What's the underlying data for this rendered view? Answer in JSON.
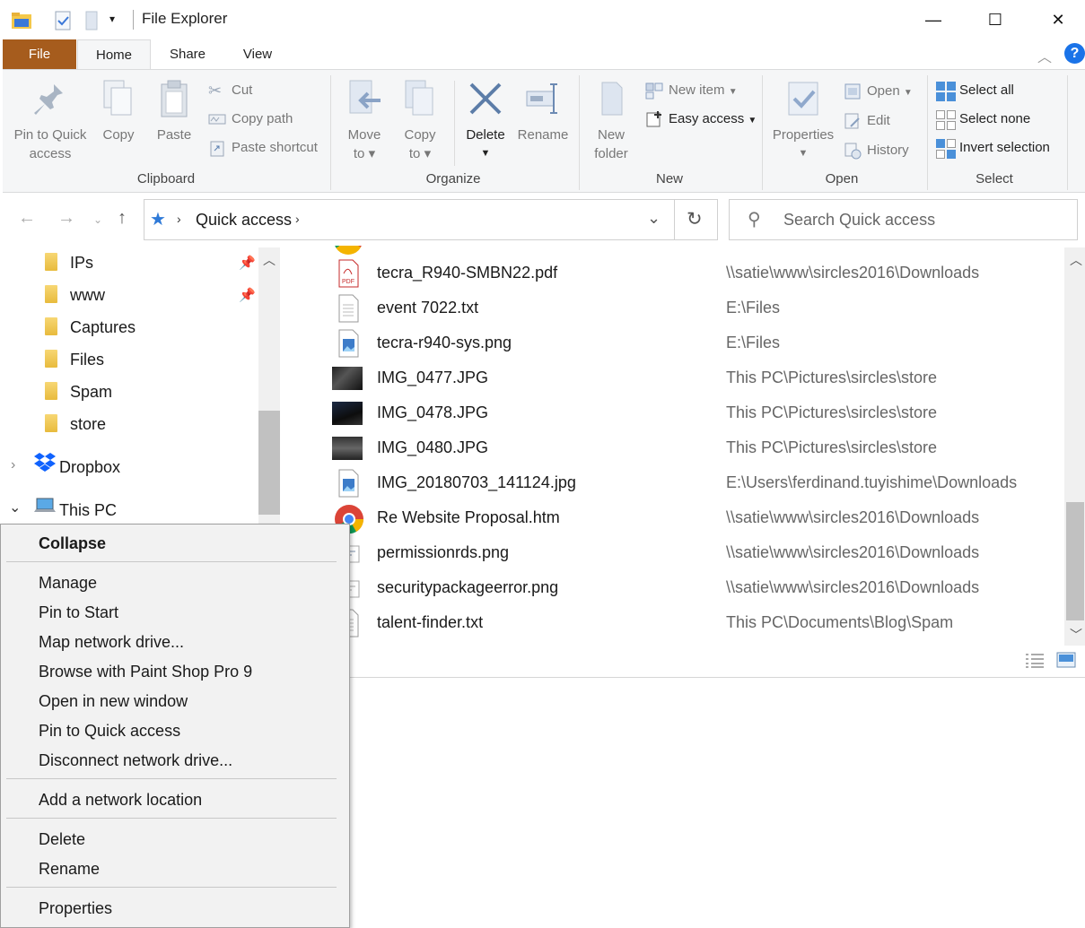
{
  "window": {
    "title": "File Explorer"
  },
  "window_controls": {
    "minimize": "—",
    "maximize": "☐",
    "close": "✕"
  },
  "tabs": [
    {
      "label": "File"
    },
    {
      "label": "Home"
    },
    {
      "label": "Share"
    },
    {
      "label": "View"
    }
  ],
  "ribbon": {
    "clipboard": {
      "label": "Clipboard",
      "pin_line1": "Pin to Quick",
      "pin_line2": "access",
      "copy": "Copy",
      "paste": "Paste",
      "cut": "Cut",
      "copy_path": "Copy path",
      "paste_shortcut": "Paste shortcut"
    },
    "organize": {
      "label": "Organize",
      "move_line1": "Move",
      "move_line2": "to",
      "copy_line1": "Copy",
      "copy_line2": "to",
      "delete": "Delete",
      "rename": "Rename"
    },
    "new": {
      "label": "New",
      "new_folder_line1": "New",
      "new_folder_line2": "folder",
      "new_item": "New item",
      "easy_access": "Easy access"
    },
    "open": {
      "label": "Open",
      "properties": "Properties",
      "open": "Open",
      "edit": "Edit",
      "history": "History"
    },
    "select": {
      "label": "Select",
      "select_all": "Select all",
      "select_none": "Select none",
      "invert_selection": "Invert selection"
    }
  },
  "address": {
    "path": "Quick access",
    "search_placeholder": "Search Quick access"
  },
  "nav_pane": {
    "items": [
      {
        "label": "IPs",
        "pinned": true
      },
      {
        "label": "www",
        "pinned": true
      },
      {
        "label": "Captures",
        "pinned": false
      },
      {
        "label": "Files",
        "pinned": false
      },
      {
        "label": "Spam",
        "pinned": false
      },
      {
        "label": "store",
        "pinned": false
      }
    ],
    "dropbox": "Dropbox",
    "this_pc": "This PC"
  },
  "files": [
    {
      "name": "tecra_R940-SMBN22.pdf",
      "location": "\\\\satie\\www\\sircles2016\\Downloads",
      "icon": "pdf-icon"
    },
    {
      "name": "event 7022.txt",
      "location": "E:\\Files",
      "icon": "text-file-icon"
    },
    {
      "name": "tecra-r940-sys.png",
      "location": "E:\\Files",
      "icon": "image-file-icon"
    },
    {
      "name": "IMG_0477.JPG",
      "location": "This PC\\Pictures\\sircles\\store",
      "icon": "photo-thumbnail-icon"
    },
    {
      "name": "IMG_0478.JPG",
      "location": "This PC\\Pictures\\sircles\\store",
      "icon": "photo-thumbnail-icon"
    },
    {
      "name": "IMG_0480.JPG",
      "location": "This PC\\Pictures\\sircles\\store",
      "icon": "photo-thumbnail-icon"
    },
    {
      "name": "IMG_20180703_141124.jpg",
      "location": "E:\\Users\\ferdinand.tuyishime\\Downloads",
      "icon": "image-file-icon"
    },
    {
      "name": "Re Website Proposal.htm",
      "location": "\\\\satie\\www\\sircles2016\\Downloads",
      "icon": "chrome-icon"
    },
    {
      "name": "permissionrds.png",
      "location": "\\\\satie\\www\\sircles2016\\Downloads",
      "icon": "image-file-icon"
    },
    {
      "name": "securitypackageerror.png",
      "location": "\\\\satie\\www\\sircles2016\\Downloads",
      "icon": "image-file-icon"
    },
    {
      "name": "talent-finder.txt",
      "location": "This PC\\Documents\\Blog\\Spam",
      "icon": "text-file-icon"
    }
  ],
  "context_menu": {
    "collapse": "Collapse",
    "manage": "Manage",
    "pin_to_start": "Pin to Start",
    "map_network_drive": "Map network drive...",
    "browse_psp": "Browse with Paint Shop Pro 9",
    "open_new_window": "Open in new window",
    "pin_quick_access": "Pin to Quick access",
    "disconnect_network_drive": "Disconnect network drive...",
    "add_network_location": "Add a network location",
    "delete": "Delete",
    "rename": "Rename",
    "properties": "Properties"
  },
  "colors": {
    "file_tab": "#a65c1d",
    "selected_nav": "#cce8ff",
    "help": "#1a73e8"
  }
}
